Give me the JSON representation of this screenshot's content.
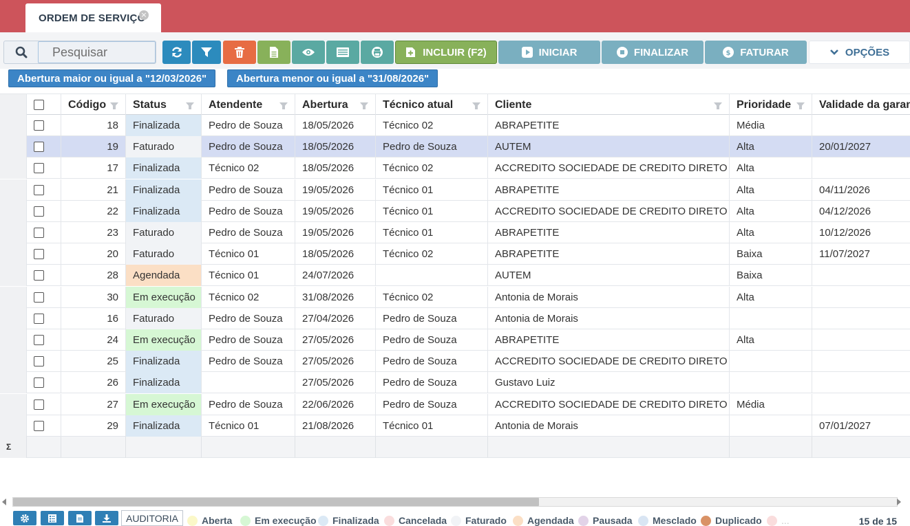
{
  "tab": {
    "title": "ORDEM DE SERVIÇO",
    "close_glyph": "×"
  },
  "toolbar": {
    "search_placeholder": "Pesquisar",
    "buttons": {
      "refresh": {
        "icon": "refresh-icon",
        "color": "#2c8bbd"
      },
      "filter": {
        "icon": "funnel-icon",
        "color": "#2c8bbd"
      },
      "delete": {
        "icon": "trash-icon",
        "color": "#e76c43"
      },
      "document": {
        "icon": "document-icon",
        "color": "#88b15a"
      },
      "view": {
        "icon": "eye-icon",
        "color": "#5aa9a2"
      },
      "list": {
        "icon": "list-icon",
        "color": "#5aa9a2"
      },
      "print": {
        "icon": "print-icon",
        "color": "#5aa9a2"
      },
      "incluir": {
        "label": "INCLUIR (F2)",
        "icon": "add-document-icon",
        "color": "#88b15a"
      },
      "iniciar": {
        "label": "INICIAR",
        "icon": "play-icon",
        "color": "#7aafc0"
      },
      "finalizar": {
        "label": "FINALIZAR",
        "icon": "stop-icon",
        "color": "#7aafc0"
      },
      "faturar": {
        "label": "FATURAR",
        "icon": "money-icon",
        "color": "#7aafc0"
      },
      "opcoes": {
        "label": "OPÇÕES",
        "icon": "chevron-down-icon"
      }
    }
  },
  "filters": [
    "Abertura maior ou igual a \"12/03/2026\"",
    "Abertura menor ou igual a \"31/08/2026\""
  ],
  "table": {
    "headers": {
      "codigo": "Código",
      "status": "Status",
      "atendente": "Atendente",
      "abertura": "Abertura",
      "tecnico": "Técnico atual",
      "cliente": "Cliente",
      "prioridade": "Prioridade",
      "validade": "Validade da garantia"
    },
    "rows": [
      {
        "codigo": "18",
        "status": "Finalizada",
        "atendente": "Pedro de Souza",
        "abertura": "18/05/2026",
        "tecnico": "Técnico 02",
        "cliente": "ABRAPETITE",
        "prioridade": "Média",
        "validade": "",
        "selected": false
      },
      {
        "codigo": "19",
        "status": "Faturado",
        "atendente": "Pedro de Souza",
        "abertura": "18/05/2026",
        "tecnico": "Pedro de Souza",
        "cliente": "AUTEM",
        "prioridade": "Alta",
        "validade": "20/01/2027",
        "selected": true
      },
      {
        "codigo": "17",
        "status": "Finalizada",
        "atendente": "Técnico 02",
        "abertura": "18/05/2026",
        "tecnico": "Técnico 02",
        "cliente": "ACCREDITO SOCIEDADE DE CREDITO DIRETO S.A.",
        "prioridade": "Alta",
        "validade": "",
        "selected": false
      },
      {
        "codigo": "21",
        "status": "Finalizada",
        "atendente": "Pedro de Souza",
        "abertura": "19/05/2026",
        "tecnico": "Técnico 01",
        "cliente": "ABRAPETITE",
        "prioridade": "Alta",
        "validade": "04/11/2026",
        "selected": false
      },
      {
        "codigo": "22",
        "status": "Finalizada",
        "atendente": "Pedro de Souza",
        "abertura": "19/05/2026",
        "tecnico": "Técnico 01",
        "cliente": "ACCREDITO SOCIEDADE DE CREDITO DIRETO S.A.",
        "prioridade": "Alta",
        "validade": "04/12/2026",
        "selected": false
      },
      {
        "codigo": "23",
        "status": "Faturado",
        "atendente": "Pedro de Souza",
        "abertura": "19/05/2026",
        "tecnico": "Técnico 01",
        "cliente": "ABRAPETITE",
        "prioridade": "Alta",
        "validade": "10/12/2026",
        "selected": false
      },
      {
        "codigo": "20",
        "status": "Faturado",
        "atendente": "Técnico 01",
        "abertura": "18/05/2026",
        "tecnico": "Técnico 02",
        "cliente": "ABRAPETITE",
        "prioridade": "Baixa",
        "validade": "11/07/2027",
        "selected": false
      },
      {
        "codigo": "28",
        "status": "Agendada",
        "atendente": "Técnico 01",
        "abertura": "24/07/2026",
        "tecnico": "",
        "cliente": "AUTEM",
        "prioridade": "Baixa",
        "validade": "",
        "selected": false
      },
      {
        "codigo": "30",
        "status": "Em execução",
        "atendente": "Técnico 02",
        "abertura": "31/08/2026",
        "tecnico": "Técnico 02",
        "cliente": "Antonia de Morais",
        "prioridade": "Alta",
        "validade": "",
        "selected": false
      },
      {
        "codigo": "16",
        "status": "Faturado",
        "atendente": "Pedro de Souza",
        "abertura": "27/04/2026",
        "tecnico": "Pedro de Souza",
        "cliente": "Antonia de Morais",
        "prioridade": "",
        "validade": "",
        "selected": false
      },
      {
        "codigo": "24",
        "status": "Em execução",
        "atendente": "Pedro de Souza",
        "abertura": "27/05/2026",
        "tecnico": "Pedro de Souza",
        "cliente": "ABRAPETITE",
        "prioridade": "Alta",
        "validade": "",
        "selected": false
      },
      {
        "codigo": "25",
        "status": "Finalizada",
        "atendente": "Pedro de Souza",
        "abertura": "27/05/2026",
        "tecnico": "Pedro de Souza",
        "cliente": "ACCREDITO SOCIEDADE DE CREDITO DIRETO S.A.",
        "prioridade": "",
        "validade": "",
        "selected": false
      },
      {
        "codigo": "26",
        "status": "Finalizada",
        "atendente": "",
        "abertura": "27/05/2026",
        "tecnico": "Pedro de Souza",
        "cliente": "Gustavo Luiz",
        "prioridade": "",
        "validade": "",
        "selected": false
      },
      {
        "codigo": "27",
        "status": "Em execução",
        "atendente": "Pedro de Souza",
        "abertura": "22/06/2026",
        "tecnico": "Pedro de Souza",
        "cliente": "ACCREDITO SOCIEDADE DE CREDITO DIRETO S.A.",
        "prioridade": "Média",
        "validade": "",
        "selected": false
      },
      {
        "codigo": "29",
        "status": "Finalizada",
        "atendente": "Técnico 01",
        "abertura": "21/08/2026",
        "tecnico": "Técnico 01",
        "cliente": "Antonia de Morais",
        "prioridade": "",
        "validade": "07/01/2027",
        "selected": false
      }
    ],
    "sum_symbol": "Σ"
  },
  "status_colors": {
    "Aberta": "#fbf8c8",
    "Em execução": "#d6f7d4",
    "Finalizada": "#dbe9f5",
    "Cancelada": "#fadddd",
    "Faturado": "#f1f3f6",
    "Agendada": "#fbdfc5",
    "Pausada": "#e2d3e8",
    "Mesclado": "#d9e5f3",
    "Duplicado": "#d99266"
  },
  "footer": {
    "buttons": [
      "gear-icon",
      "checklist-icon",
      "document-icon",
      "download-icon"
    ],
    "auditoria_label": "AUDITORIA",
    "legend": [
      {
        "label": "Aberta",
        "color": "#fbf8c8"
      },
      {
        "label": "Em execução",
        "color": "#d6f7d4"
      },
      {
        "label": "Finalizada",
        "color": "#dbe9f5"
      },
      {
        "label": "Cancelada",
        "color": "#fadddd"
      },
      {
        "label": "Faturado",
        "color": "#f1f3f6"
      },
      {
        "label": "Agendada",
        "color": "#fbdfc5"
      },
      {
        "label": "Pausada",
        "color": "#e2d3e8"
      },
      {
        "label": "Mesclado",
        "color": "#d9e5f3"
      },
      {
        "label": "Duplicado",
        "color": "#d99266"
      },
      {
        "label": "...",
        "color": "#fadddd"
      }
    ],
    "count": "15 de 15"
  }
}
